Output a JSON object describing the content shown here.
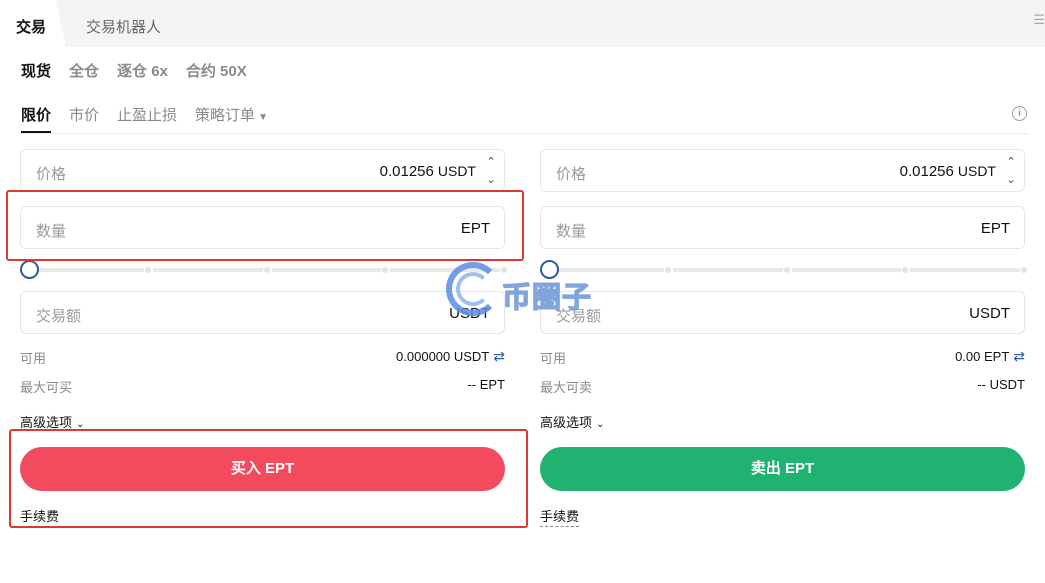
{
  "tabs": [
    "交易",
    "交易机器人"
  ],
  "modes": [
    "现货",
    "全仓",
    "逐仓 6x",
    "合约 50X"
  ],
  "order_types": [
    "限价",
    "市价",
    "止盈止损",
    "策略订单"
  ],
  "icons": {
    "info": "info-circle-icon",
    "menu": "menu-icon",
    "swap": "swap-arrows-icon",
    "chevron": "chevron-down-icon",
    "stepper_up": "chevron-up-icon",
    "stepper_down": "chevron-down-icon"
  },
  "glyphs": {
    "info": "i",
    "menu": "☰",
    "swap": "⇄",
    "up": "⌃",
    "down": "⌄",
    "caret": "▼",
    "chev": "⌄"
  },
  "buy": {
    "price_label": "价格",
    "price_value": "0.01256",
    "price_unit": "USDT",
    "qty_label": "数量",
    "qty_unit": "EPT",
    "amount_label": "交易额",
    "amount_unit": "USDT",
    "slider_percent": 0,
    "available_label": "可用",
    "available_value": "0.000000 USDT",
    "max_label": "最大可买",
    "max_value": "-- EPT",
    "advanced_label": "高级选项",
    "button_label": "买入 EPT",
    "fee_label": "手续费"
  },
  "sell": {
    "price_label": "价格",
    "price_value": "0.01256",
    "price_unit": "USDT",
    "qty_label": "数量",
    "qty_unit": "EPT",
    "amount_label": "交易额",
    "amount_unit": "USDT",
    "slider_percent": 0,
    "available_label": "可用",
    "available_value": "0.00 EPT",
    "max_label": "最大可卖",
    "max_value": "-- USDT",
    "advanced_label": "高级选项",
    "button_label": "卖出 EPT",
    "fee_label": "手续费"
  },
  "colors": {
    "buy": "#f24b5e",
    "sell": "#1fb271",
    "accent": "#2c5aa6",
    "highlight": "#dc3a31"
  },
  "watermark": "币圈子"
}
